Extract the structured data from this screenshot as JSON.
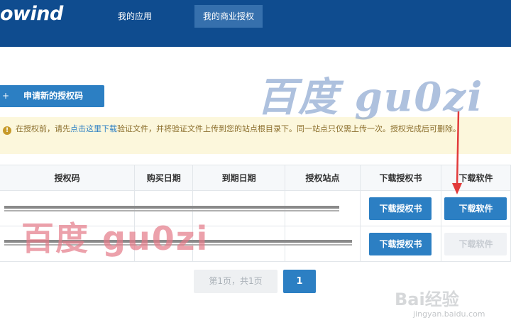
{
  "navbar": {
    "logo": "owind",
    "items": [
      {
        "label": "我的应用"
      },
      {
        "label": "我的商业授权"
      }
    ]
  },
  "actions": {
    "plus_icon": "+",
    "apply_label": "申请新的授权码"
  },
  "notice": {
    "icon": "warning-icon",
    "text_before": "在授权前，请先",
    "link_text": "点击这里下载",
    "text_after": "验证文件，并将验证文件上传到您的站点根目录下。同一站点只仅需上传一次。授权完成后可删除。"
  },
  "table": {
    "headers": [
      "授权码",
      "购买日期",
      "到期日期",
      "授权站点",
      "下载授权书",
      "下载软件"
    ],
    "rows": [
      {
        "download_license": "下载授权书",
        "download_software": "下载软件",
        "software_enabled": true
      },
      {
        "download_license": "下载授权书",
        "download_software": "下载软件",
        "software_enabled": false
      }
    ]
  },
  "pagination": {
    "info": "第1页，共1页",
    "current": "1"
  },
  "watermarks": {
    "top": "百度 gu0zi",
    "middle": "百度 gu0zi",
    "logo": "Bai经验",
    "url": "jingyan.baidu.com"
  },
  "colors": {
    "navbar": "#0f4c8f",
    "nav_active": "#3670ad",
    "primary": "#2c7fc3",
    "notice_bg": "#fcf7dc",
    "arrow": "#e23b3b"
  }
}
